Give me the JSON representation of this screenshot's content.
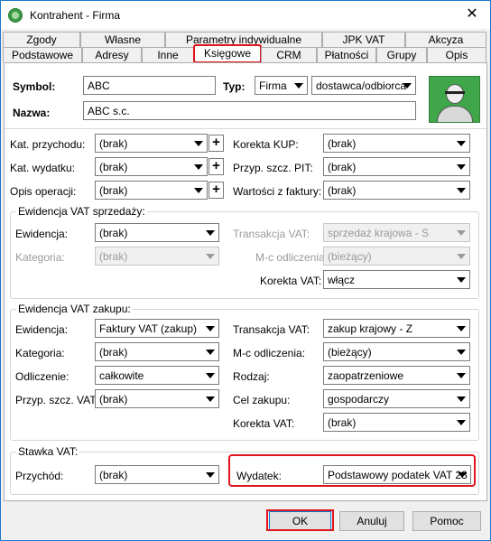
{
  "window": {
    "title": "Kontrahent - Firma",
    "close_glyph": "✕"
  },
  "tabs_row1": [
    {
      "label": "Zgody"
    },
    {
      "label": "Własne"
    },
    {
      "label": "Parametry indywidualne"
    },
    {
      "label": "JPK VAT"
    },
    {
      "label": "Akcyza"
    }
  ],
  "tabs_row2": [
    {
      "label": "Podstawowe"
    },
    {
      "label": "Adresy"
    },
    {
      "label": "Inne"
    },
    {
      "label": "Księgowe",
      "active": true
    },
    {
      "label": "CRM"
    },
    {
      "label": "Płatności"
    },
    {
      "label": "Grupy"
    },
    {
      "label": "Opis"
    }
  ],
  "header": {
    "symbol_label": "Symbol:",
    "symbol_value": "ABC",
    "typ_label": "Typ:",
    "typ_value": "Firma",
    "role_value": "dostawca/odbiorca",
    "nazwa_label": "Nazwa:",
    "nazwa_value": "ABC s.c."
  },
  "accounting": {
    "kat_przychodu_label": "Kat. przychodu:",
    "kat_przychodu_value": "(brak)",
    "kat_wydatku_label": "Kat. wydatku:",
    "kat_wydatku_value": "(brak)",
    "opis_operacji_label": "Opis operacji:",
    "opis_operacji_value": "(brak)",
    "korekta_kup_label": "Korekta KUP:",
    "korekta_kup_value": "(brak)",
    "przyp_szcz_pit_label": "Przyp. szcz. PIT:",
    "przyp_szcz_pit_value": "(brak)",
    "wartosci_label": "Wartości z faktury:",
    "wartosci_value": "(brak)",
    "plus": "+"
  },
  "sprzedaz": {
    "title": "Ewidencja VAT sprzedaży:",
    "ewidencja_label": "Ewidencja:",
    "ewidencja_value": "(brak)",
    "kategoria_label": "Kategoria:",
    "kategoria_value": "(brak)",
    "transakcja_label": "Transakcja VAT:",
    "transakcja_value": "sprzedaż krajowa - S",
    "mc_label": "M-c odliczenia:",
    "mc_value": "(bieżący)",
    "korekta_label": "Korekta VAT:",
    "korekta_value": "włącz"
  },
  "zakup": {
    "title": "Ewidencja VAT zakupu:",
    "ewidencja_label": "Ewidencja:",
    "ewidencja_value": "Faktury VAT (zakup)",
    "kategoria_label": "Kategoria:",
    "kategoria_value": "(brak)",
    "odliczenie_label": "Odliczenie:",
    "odliczenie_value": "całkowite",
    "przyp_label": "Przyp. szcz. VAT:",
    "przyp_value": "(brak)",
    "transakcja_label": "Transakcja VAT:",
    "transakcja_value": "zakup krajowy - Z",
    "mc_label": "M-c odliczenia:",
    "mc_value": "(bieżący)",
    "rodzaj_label": "Rodzaj:",
    "rodzaj_value": "zaopatrzeniowe",
    "cel_label": "Cel zakupu:",
    "cel_value": "gospodarczy",
    "korekta_label": "Korekta VAT:",
    "korekta_value": "(brak)"
  },
  "stawka": {
    "title": "Stawka VAT:",
    "przychod_label": "Przychód:",
    "przychod_value": "(brak)",
    "wydatek_label": "Wydatek:",
    "wydatek_value": "Podstawowy podatek VAT 23"
  },
  "buttons": {
    "ok": "OK",
    "cancel": "Anuluj",
    "help": "Pomoc"
  },
  "colors": {
    "highlight": "#e0141b",
    "avatar_bg": "#3fa64a",
    "focus_border": "#0078d7"
  }
}
